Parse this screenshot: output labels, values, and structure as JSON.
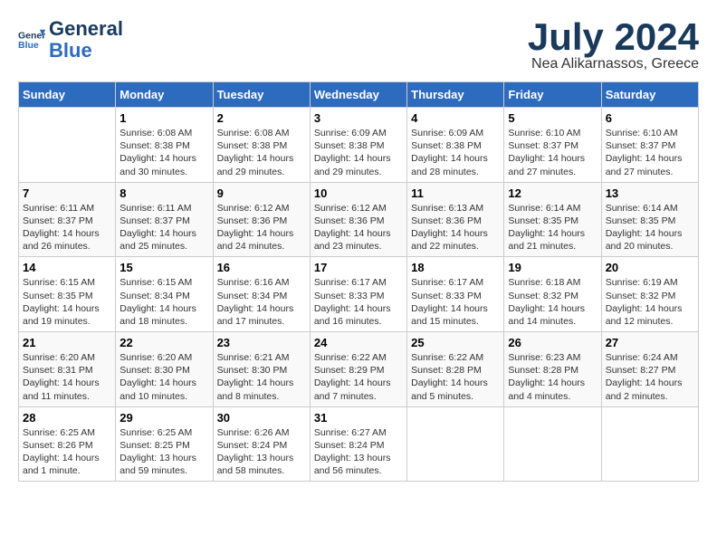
{
  "logo": {
    "line1": "General",
    "line2": "Blue"
  },
  "title": "July 2024",
  "subtitle": "Nea Alikarnassos, Greece",
  "days_header": [
    "Sunday",
    "Monday",
    "Tuesday",
    "Wednesday",
    "Thursday",
    "Friday",
    "Saturday"
  ],
  "weeks": [
    [
      {
        "num": "",
        "info": ""
      },
      {
        "num": "1",
        "info": "Sunrise: 6:08 AM\nSunset: 8:38 PM\nDaylight: 14 hours\nand 30 minutes."
      },
      {
        "num": "2",
        "info": "Sunrise: 6:08 AM\nSunset: 8:38 PM\nDaylight: 14 hours\nand 29 minutes."
      },
      {
        "num": "3",
        "info": "Sunrise: 6:09 AM\nSunset: 8:38 PM\nDaylight: 14 hours\nand 29 minutes."
      },
      {
        "num": "4",
        "info": "Sunrise: 6:09 AM\nSunset: 8:38 PM\nDaylight: 14 hours\nand 28 minutes."
      },
      {
        "num": "5",
        "info": "Sunrise: 6:10 AM\nSunset: 8:37 PM\nDaylight: 14 hours\nand 27 minutes."
      },
      {
        "num": "6",
        "info": "Sunrise: 6:10 AM\nSunset: 8:37 PM\nDaylight: 14 hours\nand 27 minutes."
      }
    ],
    [
      {
        "num": "7",
        "info": "Sunrise: 6:11 AM\nSunset: 8:37 PM\nDaylight: 14 hours\nand 26 minutes."
      },
      {
        "num": "8",
        "info": "Sunrise: 6:11 AM\nSunset: 8:37 PM\nDaylight: 14 hours\nand 25 minutes."
      },
      {
        "num": "9",
        "info": "Sunrise: 6:12 AM\nSunset: 8:36 PM\nDaylight: 14 hours\nand 24 minutes."
      },
      {
        "num": "10",
        "info": "Sunrise: 6:12 AM\nSunset: 8:36 PM\nDaylight: 14 hours\nand 23 minutes."
      },
      {
        "num": "11",
        "info": "Sunrise: 6:13 AM\nSunset: 8:36 PM\nDaylight: 14 hours\nand 22 minutes."
      },
      {
        "num": "12",
        "info": "Sunrise: 6:14 AM\nSunset: 8:35 PM\nDaylight: 14 hours\nand 21 minutes."
      },
      {
        "num": "13",
        "info": "Sunrise: 6:14 AM\nSunset: 8:35 PM\nDaylight: 14 hours\nand 20 minutes."
      }
    ],
    [
      {
        "num": "14",
        "info": "Sunrise: 6:15 AM\nSunset: 8:35 PM\nDaylight: 14 hours\nand 19 minutes."
      },
      {
        "num": "15",
        "info": "Sunrise: 6:15 AM\nSunset: 8:34 PM\nDaylight: 14 hours\nand 18 minutes."
      },
      {
        "num": "16",
        "info": "Sunrise: 6:16 AM\nSunset: 8:34 PM\nDaylight: 14 hours\nand 17 minutes."
      },
      {
        "num": "17",
        "info": "Sunrise: 6:17 AM\nSunset: 8:33 PM\nDaylight: 14 hours\nand 16 minutes."
      },
      {
        "num": "18",
        "info": "Sunrise: 6:17 AM\nSunset: 8:33 PM\nDaylight: 14 hours\nand 15 minutes."
      },
      {
        "num": "19",
        "info": "Sunrise: 6:18 AM\nSunset: 8:32 PM\nDaylight: 14 hours\nand 14 minutes."
      },
      {
        "num": "20",
        "info": "Sunrise: 6:19 AM\nSunset: 8:32 PM\nDaylight: 14 hours\nand 12 minutes."
      }
    ],
    [
      {
        "num": "21",
        "info": "Sunrise: 6:20 AM\nSunset: 8:31 PM\nDaylight: 14 hours\nand 11 minutes."
      },
      {
        "num": "22",
        "info": "Sunrise: 6:20 AM\nSunset: 8:30 PM\nDaylight: 14 hours\nand 10 minutes."
      },
      {
        "num": "23",
        "info": "Sunrise: 6:21 AM\nSunset: 8:30 PM\nDaylight: 14 hours\nand 8 minutes."
      },
      {
        "num": "24",
        "info": "Sunrise: 6:22 AM\nSunset: 8:29 PM\nDaylight: 14 hours\nand 7 minutes."
      },
      {
        "num": "25",
        "info": "Sunrise: 6:22 AM\nSunset: 8:28 PM\nDaylight: 14 hours\nand 5 minutes."
      },
      {
        "num": "26",
        "info": "Sunrise: 6:23 AM\nSunset: 8:28 PM\nDaylight: 14 hours\nand 4 minutes."
      },
      {
        "num": "27",
        "info": "Sunrise: 6:24 AM\nSunset: 8:27 PM\nDaylight: 14 hours\nand 2 minutes."
      }
    ],
    [
      {
        "num": "28",
        "info": "Sunrise: 6:25 AM\nSunset: 8:26 PM\nDaylight: 14 hours\nand 1 minute."
      },
      {
        "num": "29",
        "info": "Sunrise: 6:25 AM\nSunset: 8:25 PM\nDaylight: 13 hours\nand 59 minutes."
      },
      {
        "num": "30",
        "info": "Sunrise: 6:26 AM\nSunset: 8:24 PM\nDaylight: 13 hours\nand 58 minutes."
      },
      {
        "num": "31",
        "info": "Sunrise: 6:27 AM\nSunset: 8:24 PM\nDaylight: 13 hours\nand 56 minutes."
      },
      {
        "num": "",
        "info": ""
      },
      {
        "num": "",
        "info": ""
      },
      {
        "num": "",
        "info": ""
      }
    ]
  ]
}
